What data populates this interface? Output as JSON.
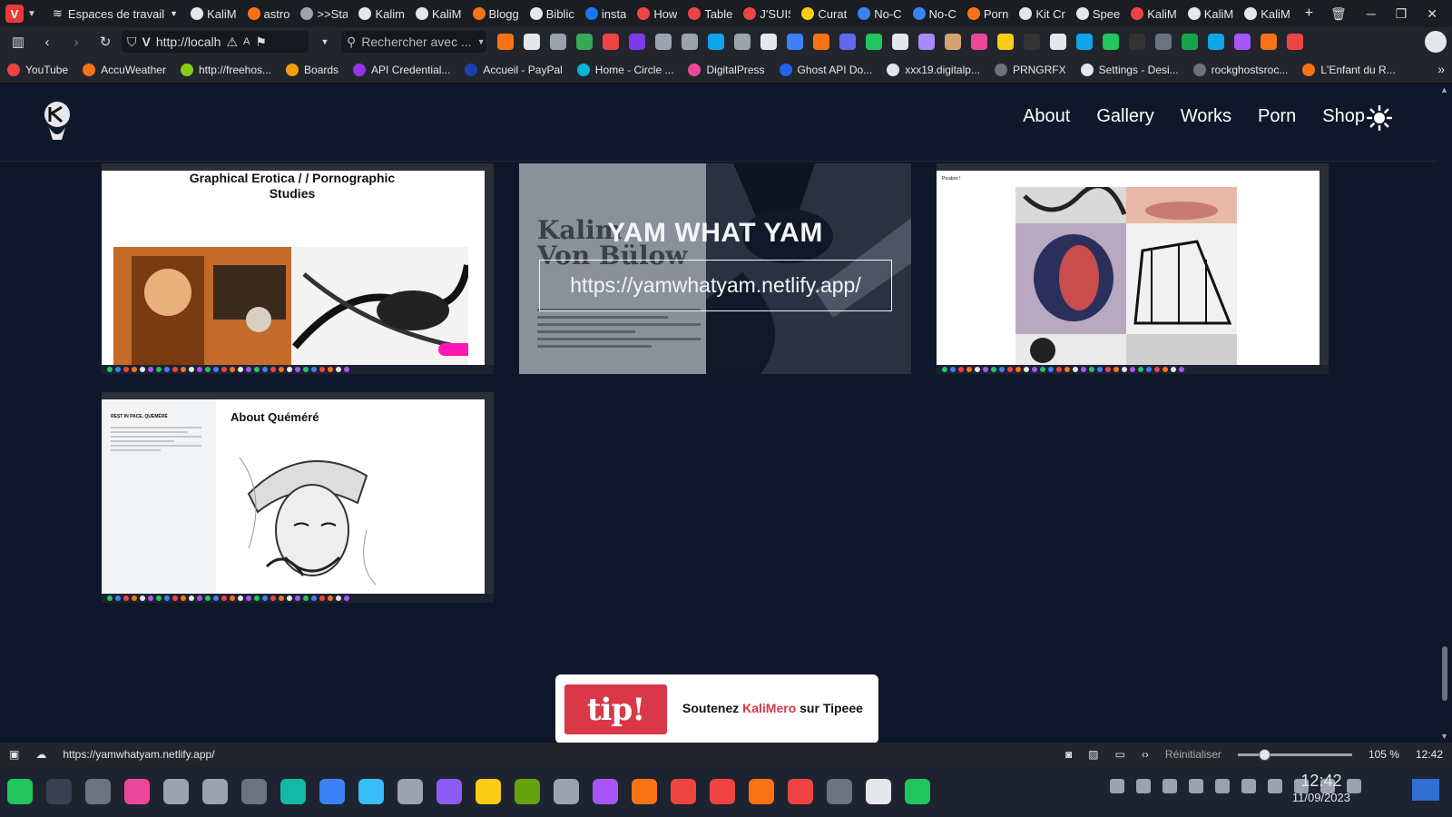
{
  "browser": {
    "workspace_label": "Espaces de travail",
    "tabs": [
      {
        "label": "KaliM",
        "color": "#e5e7eb"
      },
      {
        "label": "astro",
        "color": "#f97316"
      },
      {
        "label": ">>Sta",
        "color": "#9ca3af"
      },
      {
        "label": "Kalim",
        "color": "#e5e7eb"
      },
      {
        "label": "KaliM",
        "color": "#e5e7eb"
      },
      {
        "label": "Blogg",
        "color": "#f97316"
      },
      {
        "label": "Biblic",
        "color": "#e5e7eb"
      },
      {
        "label": "insta",
        "color": "#1877f2"
      },
      {
        "label": "How",
        "color": "#ef4444"
      },
      {
        "label": "Table",
        "color": "#ef4444"
      },
      {
        "label": "J'SUIS",
        "color": "#ef4444"
      },
      {
        "label": "Curat",
        "color": "#facc15"
      },
      {
        "label": "No-C",
        "color": "#3b82f6"
      },
      {
        "label": "No-C",
        "color": "#3b82f6"
      },
      {
        "label": "Porn",
        "color": "#f97316"
      },
      {
        "label": "Kit Cr",
        "color": "#e5e7eb"
      },
      {
        "label": "Spee",
        "color": "#e5e7eb"
      },
      {
        "label": "KaliM",
        "color": "#ef4444"
      },
      {
        "label": "KaliM",
        "color": "#e5e7eb"
      },
      {
        "label": "KaliM",
        "color": "#e5e7eb"
      }
    ],
    "new_tab": "+",
    "url": "http://localh",
    "search_placeholder": "Rechercher avec ...",
    "bookmarks": [
      {
        "label": "YouTube",
        "color": "#ef4444"
      },
      {
        "label": "AccuWeather",
        "color": "#f97316"
      },
      {
        "label": "http://freehos...",
        "color": "#84cc16"
      },
      {
        "label": "Boards",
        "color": "#f59e0b"
      },
      {
        "label": "API Credential...",
        "color": "#9333ea"
      },
      {
        "label": "Accueil - PayPal",
        "color": "#1e40af"
      },
      {
        "label": "Home - Circle ...",
        "color": "#06b6d4"
      },
      {
        "label": "DigitalPress",
        "color": "#ec4899"
      },
      {
        "label": "Ghost API Do...",
        "color": "#2563eb"
      },
      {
        "label": "xxx19.digitalp...",
        "color": "#e5e7eb"
      },
      {
        "label": "PRNGRFX",
        "color": "#6b7280"
      },
      {
        "label": "Settings - Desi...",
        "color": "#e5e7eb"
      },
      {
        "label": "rockghostsroc...",
        "color": "#6b7280"
      },
      {
        "label": "L'Enfant du R...",
        "color": "#f97316"
      }
    ],
    "bookmarks_more": "»"
  },
  "site": {
    "nav": [
      "About",
      "Gallery",
      "Works",
      "Porn",
      "Shop"
    ],
    "cards": {
      "erotica_title": "Graphical Erotica / / Pornographic Studies",
      "yam_title": "YAM WHAT YAM",
      "yam_url": "https://yamwhatyam.netlify.app/",
      "yam_bg_name": "Kalim\nVon Bülow",
      "picabox_label": "Picabox !",
      "quemere_side_title": "REST IN PACE, QUÉMÉRÉ",
      "quemere_title": "About Quéméré"
    },
    "tip": {
      "logo": "tip!",
      "text_before": "Soutenez ",
      "highlight": "KaliMero",
      "text_after": " sur Tipeee",
      "highlight_color": "#d83848"
    }
  },
  "statusbar": {
    "hover_url": "https://yamwhatyam.netlify.app/",
    "reset_label": "Réinitialiser",
    "zoom": "105 %",
    "zoom_fraction": 0.2,
    "time": "12:42"
  },
  "taskbar": {
    "time": "12:42",
    "date": "11/09/2023"
  }
}
